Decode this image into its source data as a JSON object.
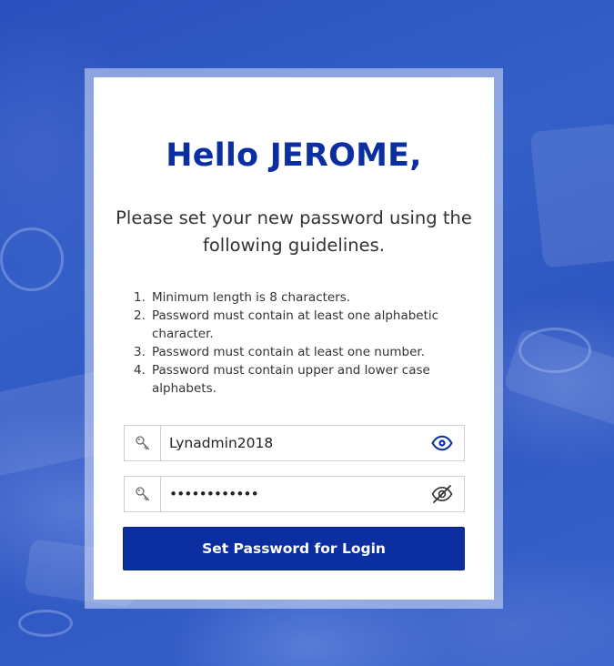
{
  "greeting": {
    "prefix": "Hello",
    "name": "JEROME",
    "suffix": ","
  },
  "subtitle": "Please set your new password using the following guidelines.",
  "guidelines": [
    {
      "num": "1.",
      "text": "Minimum length is 8 characters."
    },
    {
      "num": "2.",
      "text": "Password must contain at least one alphabetic character."
    },
    {
      "num": "3.",
      "text": "Password must contain at least one number."
    },
    {
      "num": "4.",
      "text": "Password must contain upper and lower case alphabets."
    }
  ],
  "password_field": {
    "value": "Lynadmin2018",
    "icon": "key-icon",
    "toggle_icon": "eye-icon",
    "visible": true
  },
  "confirm_field": {
    "value": "••••••••••••",
    "icon": "key-icon",
    "toggle_icon": "eye-slash-icon",
    "visible": false
  },
  "submit_label": "Set Password for Login",
  "colors": {
    "brand": "#0b2fa1",
    "background": "#2f56c0"
  }
}
